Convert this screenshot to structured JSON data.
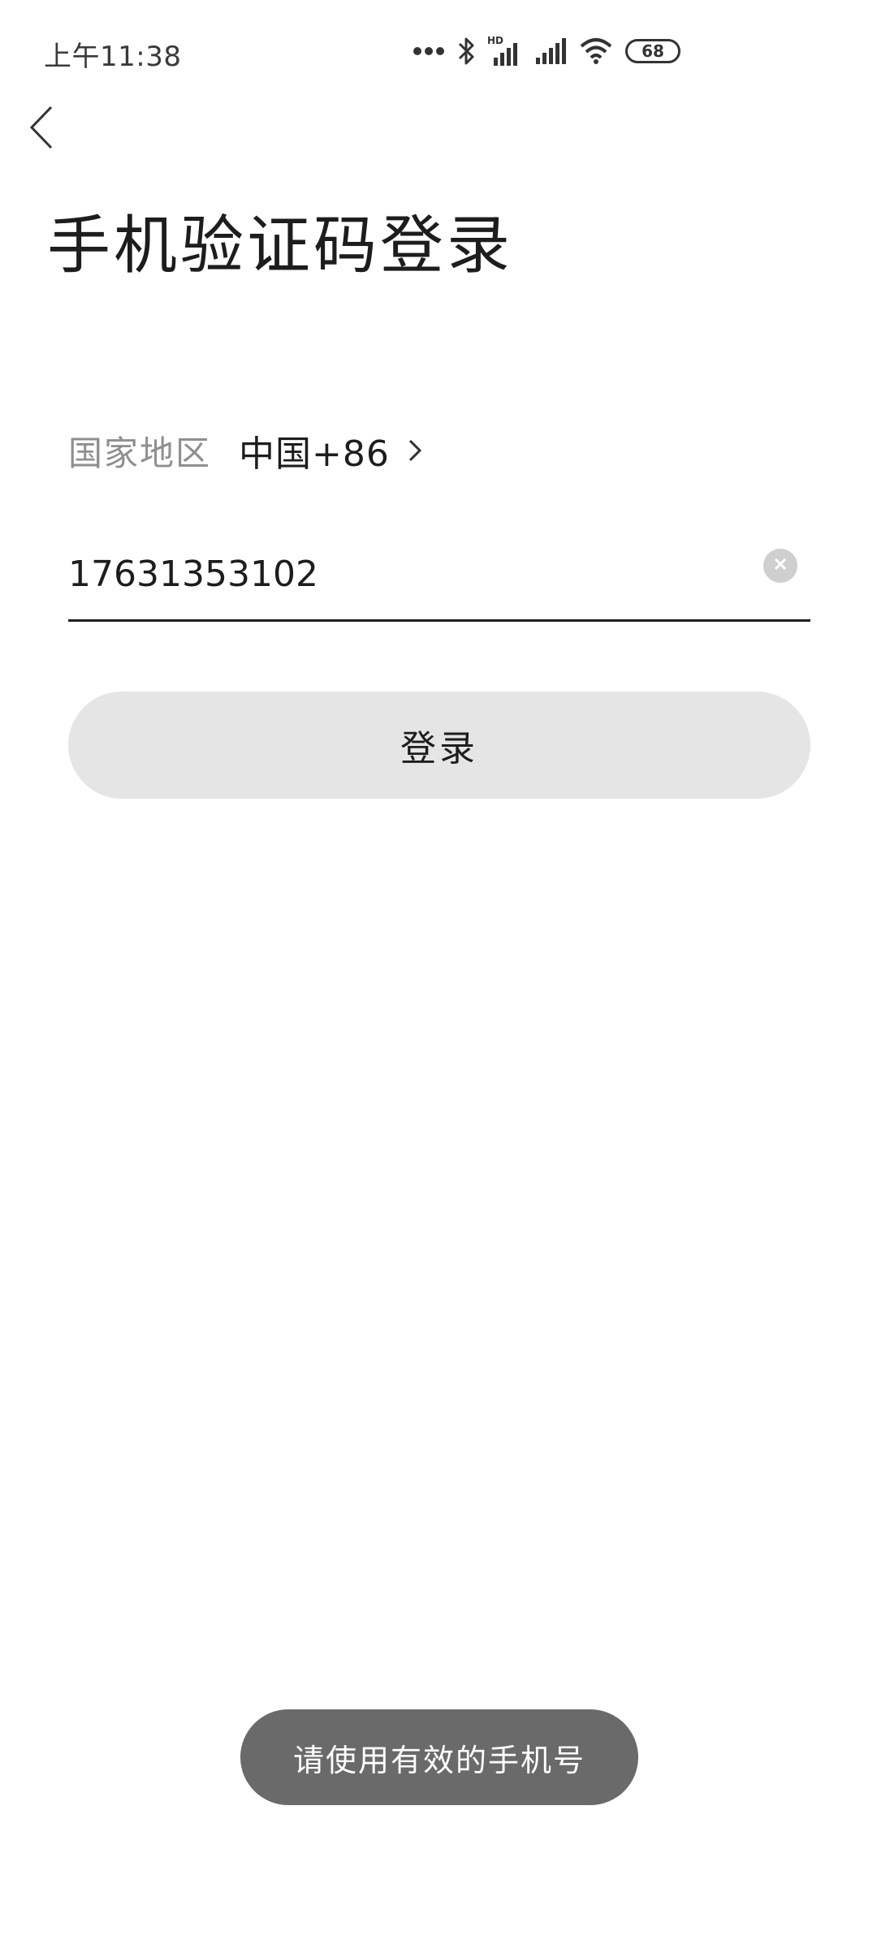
{
  "status_bar": {
    "time": "上午11:38",
    "battery_level": "68",
    "icons": [
      "more-dots-icon",
      "bluetooth-icon",
      "hd-signal-icon",
      "signal-icon",
      "wifi-icon",
      "battery-icon"
    ]
  },
  "header": {
    "back_icon": "chevron-left-icon",
    "title": "手机验证码登录"
  },
  "region": {
    "label": "国家地区",
    "value": "中国+86"
  },
  "phone": {
    "value": "17631353102",
    "placeholder": ""
  },
  "actions": {
    "login_label": "登录"
  },
  "toast": {
    "message": "请使用有效的手机号"
  },
  "colors": {
    "background": "#ffffff",
    "text_primary": "#1d1d1d",
    "text_secondary": "#8f8f8f",
    "button_bg": "#e5e5e5",
    "toast_bg": "#6a6a6a"
  }
}
